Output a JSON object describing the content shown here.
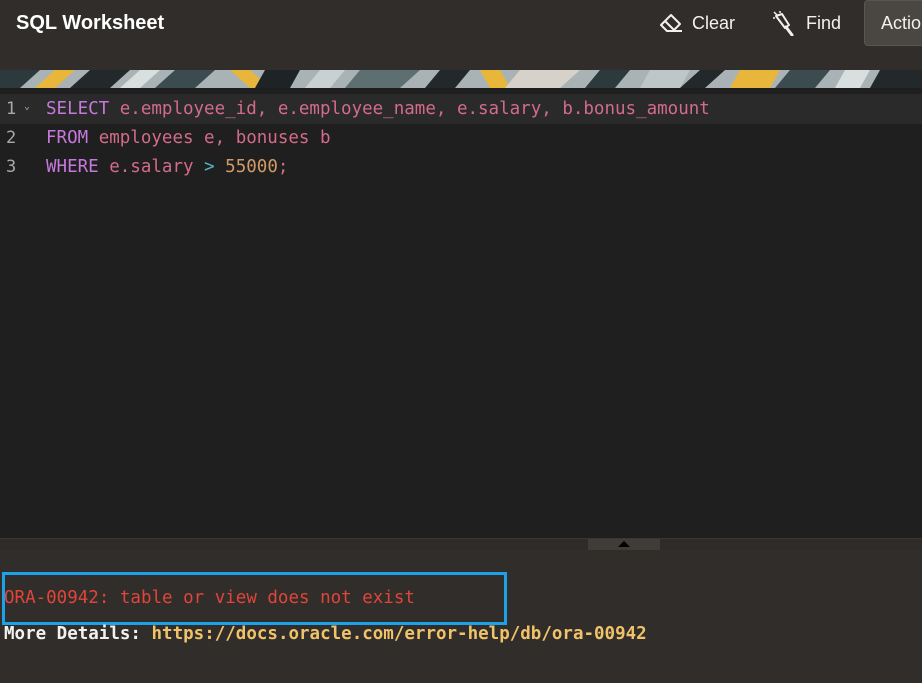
{
  "header": {
    "title": "SQL Worksheet",
    "clear_label": "Clear",
    "find_label": "Find",
    "actions_label": "Actions"
  },
  "editor": {
    "lines": [
      {
        "number": "1",
        "tokens": [
          {
            "text": "SELECT",
            "kind": "kw"
          },
          {
            "text": " ",
            "kind": "pn"
          },
          {
            "text": "e.employee_id",
            "kind": "id"
          },
          {
            "text": ", ",
            "kind": "pn"
          },
          {
            "text": "e.employee_name",
            "kind": "id"
          },
          {
            "text": ", ",
            "kind": "pn"
          },
          {
            "text": "e.salary",
            "kind": "id"
          },
          {
            "text": ", ",
            "kind": "pn"
          },
          {
            "text": "b.bonus_amount",
            "kind": "id"
          }
        ]
      },
      {
        "number": "2",
        "tokens": [
          {
            "text": "FROM",
            "kind": "kw"
          },
          {
            "text": " ",
            "kind": "pn"
          },
          {
            "text": "employees e",
            "kind": "id"
          },
          {
            "text": ", ",
            "kind": "pn"
          },
          {
            "text": "bonuses b",
            "kind": "id"
          }
        ]
      },
      {
        "number": "3",
        "tokens": [
          {
            "text": "WHERE",
            "kind": "kw"
          },
          {
            "text": " ",
            "kind": "pn"
          },
          {
            "text": "e.salary",
            "kind": "id"
          },
          {
            "text": " ",
            "kind": "pn"
          },
          {
            "text": ">",
            "kind": "op"
          },
          {
            "text": " ",
            "kind": "pn"
          },
          {
            "text": "55000",
            "kind": "num"
          },
          {
            "text": ";",
            "kind": "pn"
          }
        ]
      }
    ]
  },
  "output": {
    "error_message": "ORA-00942: table or view does not exist",
    "details_label": "More Details: ",
    "details_link": "https://docs.oracle.com/error-help/db/ora-00942"
  },
  "colors": {
    "header_bg": "#312d2a",
    "editor_bg": "#1f1f1f",
    "keyword": "#c678dd",
    "identifier": "#d36b8a",
    "number": "#d19a66",
    "error": "#e0453a",
    "link": "#f0c36a",
    "highlight_border": "#1da1e8"
  },
  "icons": {
    "clear": "eraser-icon",
    "find": "flashlight-icon",
    "fold": "chevron-down-icon",
    "splitter": "triangle-up-icon"
  }
}
